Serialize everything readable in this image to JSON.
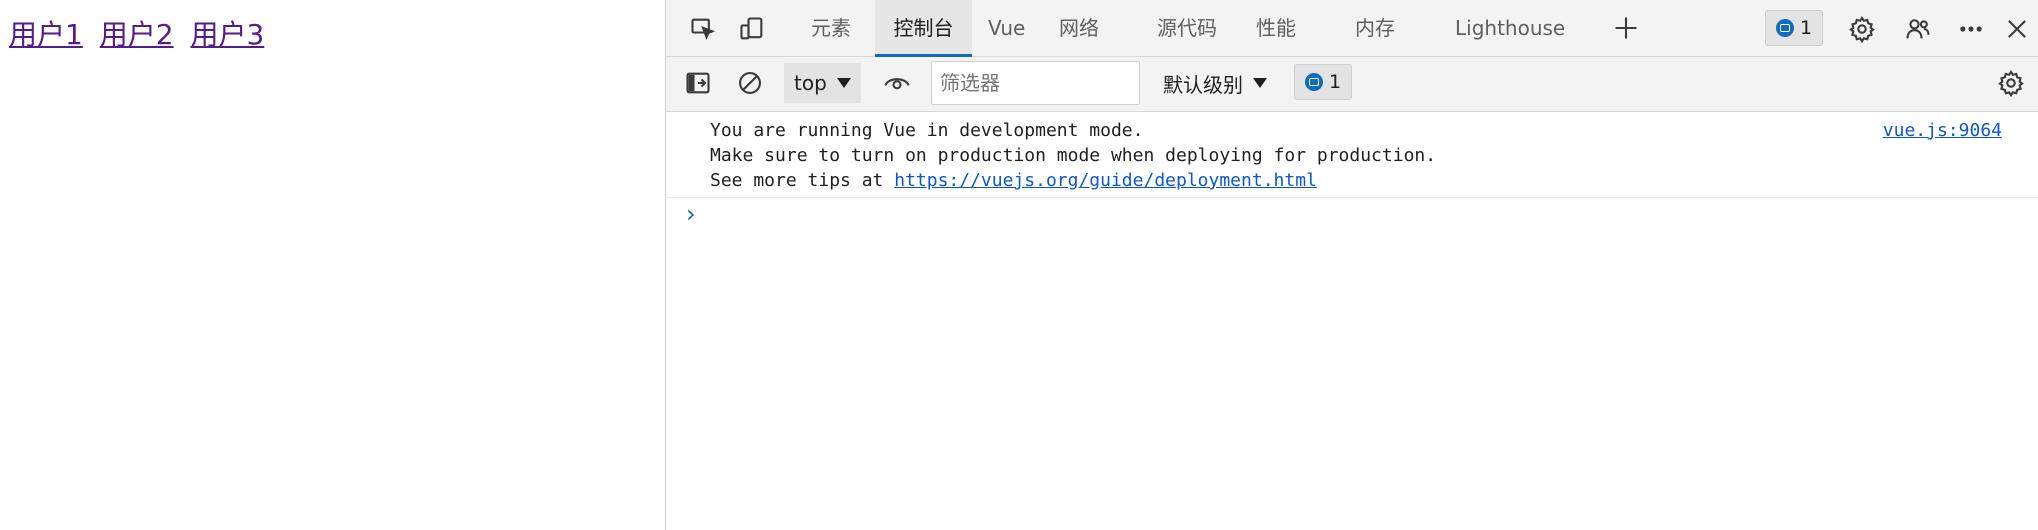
{
  "page": {
    "links": [
      "用户1",
      "用户2",
      "用户3"
    ]
  },
  "devtools": {
    "tabs": [
      "元素",
      "控制台",
      "Vue",
      "网络",
      "源代码",
      "性能",
      "内存",
      "Lighthouse"
    ],
    "active_tab": "控制台",
    "issues_count": "1",
    "toolbar": {
      "context": "top",
      "filter_placeholder": "筛选器",
      "level": "默认级别",
      "issues_count": "1"
    },
    "console": {
      "line1": "You are running Vue in development mode.",
      "line2": "Make sure to turn on production mode when deploying for production.",
      "line3_prefix": "See more tips at ",
      "line3_link": "https://vuejs.org/guide/deployment.html",
      "source": "vue.js:9064"
    },
    "colors": {
      "accent": "#0f6cbd",
      "link_visited": "#551a8b",
      "link": "#0b57d0"
    },
    "icons": [
      "inspect-icon",
      "device-toolbar-icon",
      "add-tab-icon",
      "settings-icon",
      "people-icon",
      "more-icon",
      "close-icon",
      "sidebar-toggle-icon",
      "clear-console-icon",
      "dropdown-arrow-icon",
      "live-expression-icon",
      "console-settings-icon",
      "chevron-right-icon",
      "message-icon"
    ]
  }
}
